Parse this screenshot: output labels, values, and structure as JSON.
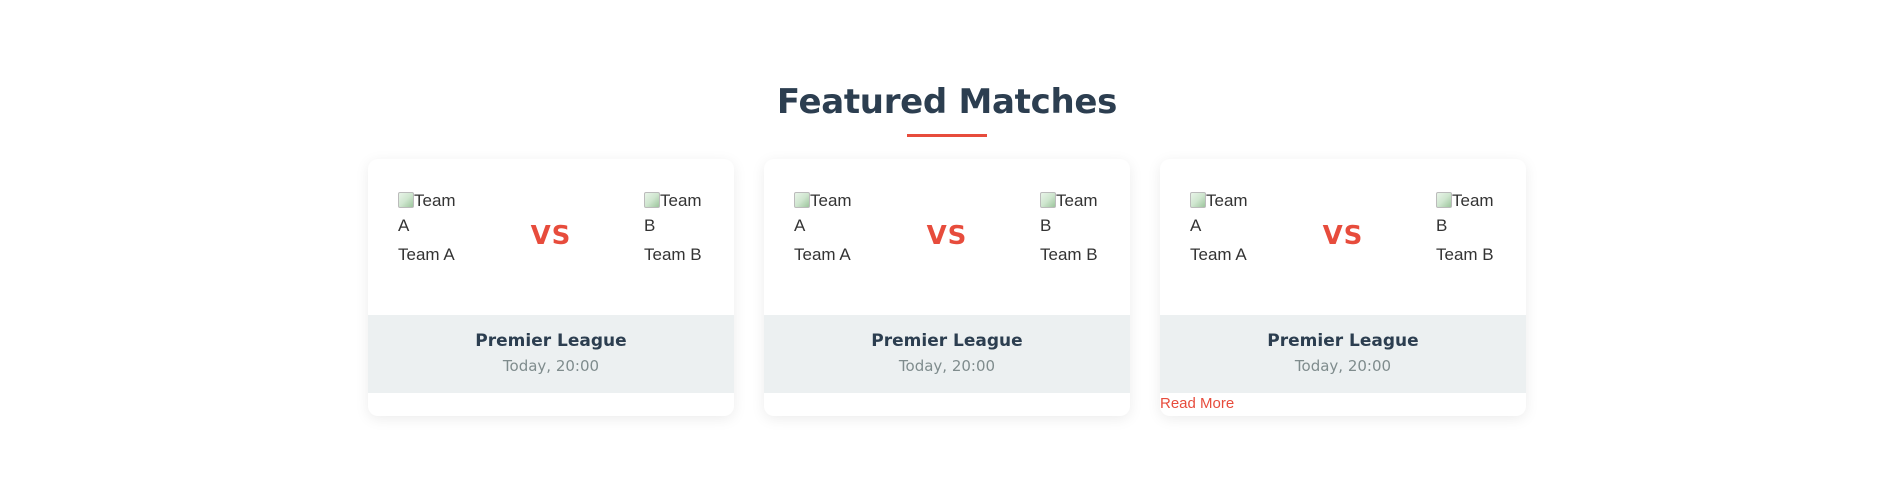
{
  "section": {
    "title": "Featured Matches"
  },
  "colors": {
    "accent": "#e74c3c",
    "heading": "#2c3e50",
    "info_background": "#ecf0f1",
    "muted_text": "#7f8c8d"
  },
  "matches": [
    {
      "team_a": {
        "logo_alt": "Team A",
        "name": "Team A"
      },
      "team_b": {
        "logo_alt": "Team B",
        "name": "Team B"
      },
      "vs_label": "VS",
      "league": "Premier League",
      "time": "Today, 20:00"
    },
    {
      "team_a": {
        "logo_alt": "Team A",
        "name": "Team A"
      },
      "team_b": {
        "logo_alt": "Team B",
        "name": "Team B"
      },
      "vs_label": "VS",
      "league": "Premier League",
      "time": "Today, 20:00"
    },
    {
      "team_a": {
        "logo_alt": "Team A",
        "name": "Team A"
      },
      "team_b": {
        "logo_alt": "Team B",
        "name": "Team B"
      },
      "vs_label": "VS",
      "league": "Premier League",
      "time": "Today, 20:00",
      "read_more_label": "Read More"
    }
  ]
}
